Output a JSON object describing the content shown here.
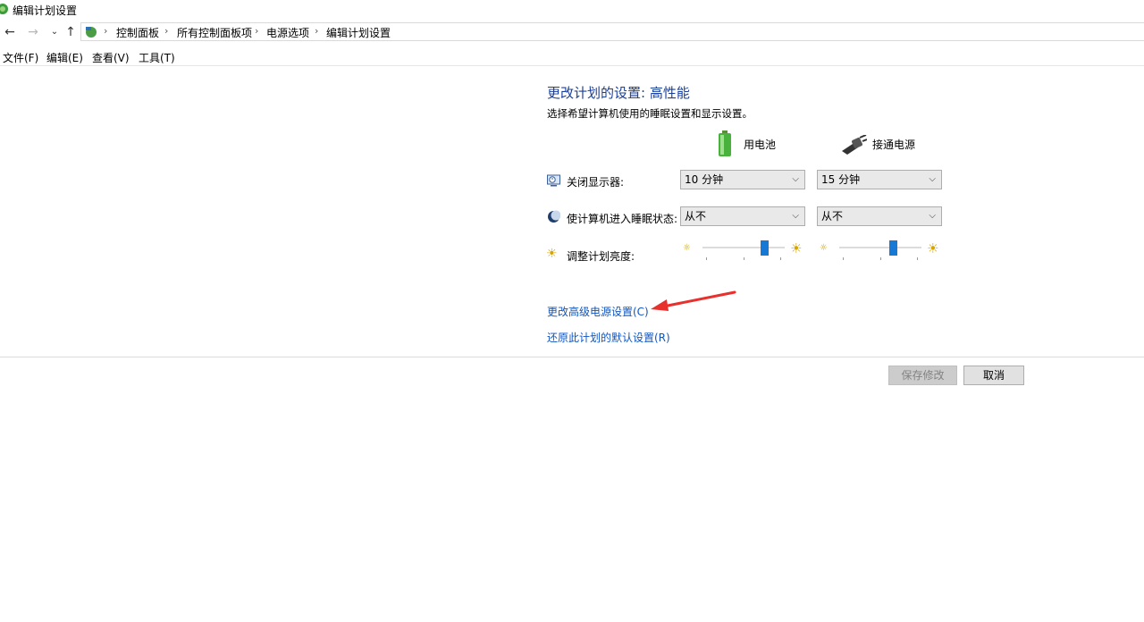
{
  "window": {
    "title": "编辑计划设置"
  },
  "nav": {
    "back_icon": "arrow-left-icon",
    "forward_icon": "arrow-right-icon",
    "recent_icon": "chevron-down-icon",
    "up_icon": "arrow-up-icon",
    "breadcrumbs": [
      "控制面板",
      "所有控制面板项",
      "电源选项",
      "编辑计划设置"
    ]
  },
  "menu": [
    "文件(F)",
    "编辑(E)",
    "查看(V)",
    "工具(T)"
  ],
  "main": {
    "heading": "更改计划的设置: 高性能",
    "subheading": "选择希望计算机使用的睡眠设置和显示设置。",
    "columns": {
      "battery": "用电池",
      "plugged": "接通电源"
    },
    "rows": {
      "display": {
        "label": "关闭显示器:",
        "battery_value": "10 分钟",
        "plugged_value": "15 分钟"
      },
      "sleep": {
        "label": "使计算机进入睡眠状态:",
        "battery_value": "从不",
        "plugged_value": "从不"
      },
      "brightness": {
        "label": "调整计划亮度:",
        "battery_level": 0.78,
        "plugged_level": 0.67
      }
    },
    "links": {
      "advanced": "更改高级电源设置(C)",
      "restore": "还原此计划的默认设置(R)"
    }
  },
  "buttons": {
    "save": "保存修改",
    "cancel": "取消",
    "save_enabled": false
  },
  "colors": {
    "heading": "#1a3f9a",
    "link": "#0f56c2",
    "slider_thumb": "#1778d6",
    "annotation_arrow": "#e8302c"
  }
}
